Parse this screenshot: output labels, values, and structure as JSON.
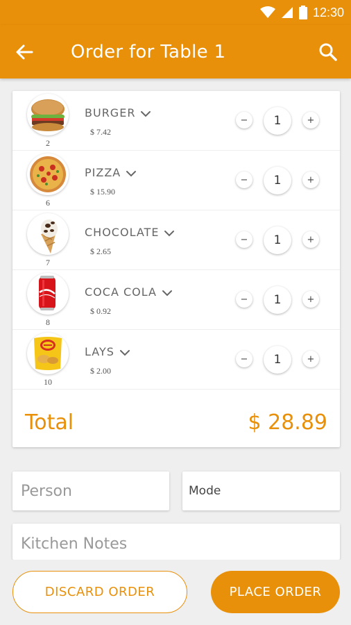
{
  "status_bar": {
    "time": "12:30",
    "icons": [
      "wifi-icon",
      "signal-icon",
      "battery-icon"
    ]
  },
  "app_bar": {
    "title": "Order for Table 1",
    "back_icon": "arrow-left-icon",
    "search_icon": "search-icon"
  },
  "items": [
    {
      "name": "BURGER",
      "price": "$ 7.42",
      "number": "2",
      "quantity": "1",
      "icon": "burger-icon"
    },
    {
      "name": "PIZZA",
      "price": "$ 15.90",
      "number": "6",
      "quantity": "1",
      "icon": "pizza-icon"
    },
    {
      "name": "CHOCOLATE",
      "price": "$ 2.65",
      "number": "7",
      "quantity": "1",
      "icon": "ice-cream-icon"
    },
    {
      "name": "COCA COLA",
      "price": "$ 0.92",
      "number": "8",
      "quantity": "1",
      "icon": "soda-can-icon"
    },
    {
      "name": "LAYS",
      "price": "$ 2.00",
      "number": "10",
      "quantity": "1",
      "icon": "chips-bag-icon"
    }
  ],
  "controls": {
    "minus": "−",
    "plus": "+"
  },
  "total": {
    "label": "Total",
    "value": "$  28.89"
  },
  "form": {
    "person_placeholder": "Person",
    "mode_label": "Mode",
    "notes_placeholder": "Kitchen Notes"
  },
  "actions": {
    "discard": "DISCARD ORDER",
    "place": "PLACE ORDER"
  },
  "colors": {
    "accent": "#e8900a",
    "background": "#efefef",
    "card": "#ffffff",
    "text": "#666666"
  }
}
